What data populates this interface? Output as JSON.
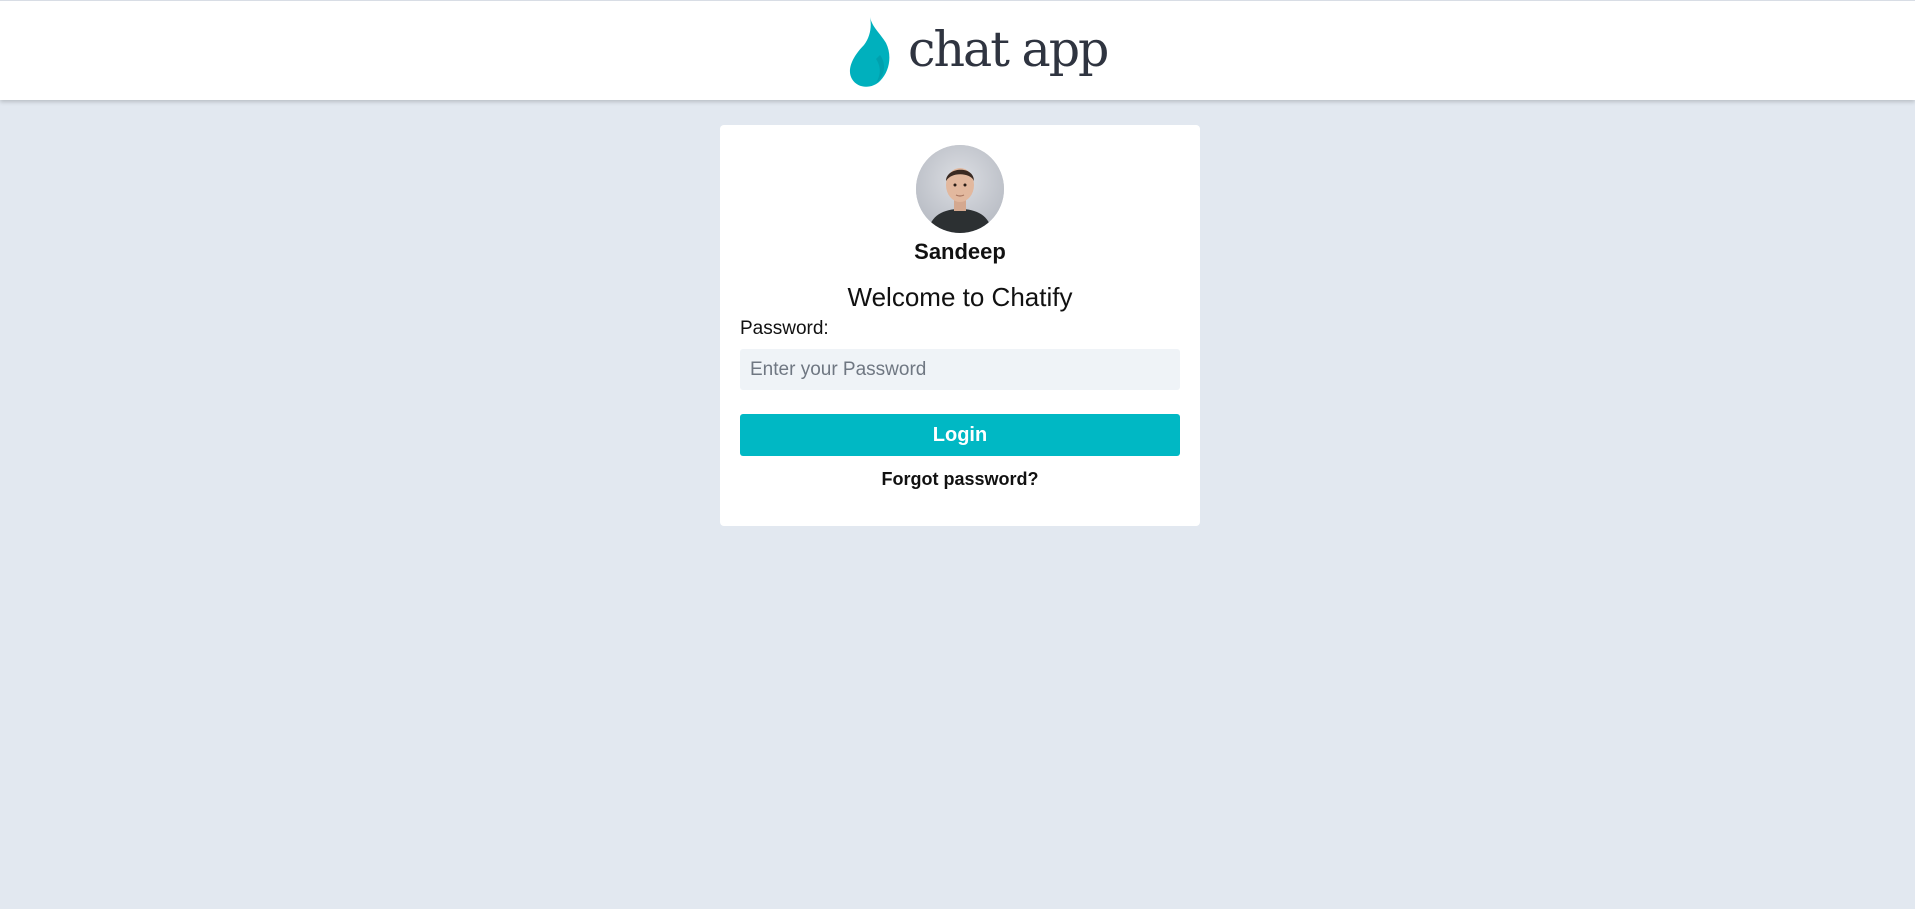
{
  "header": {
    "logo_text": "chat app",
    "logo_icon": "flame-icon",
    "brand_color": "#00b8c4"
  },
  "login": {
    "avatar_icon": "user-avatar",
    "username": "Sandeep",
    "welcome": "Welcome to Chatify",
    "password_label": "Password:",
    "password_placeholder": "Enter your Password",
    "password_value": "",
    "login_label": "Login",
    "forgot_label": "Forgot password?"
  },
  "colors": {
    "background": "#e2e8f0",
    "card": "#ffffff",
    "button": "#00b8c4",
    "input_bg": "#eff3f7"
  }
}
